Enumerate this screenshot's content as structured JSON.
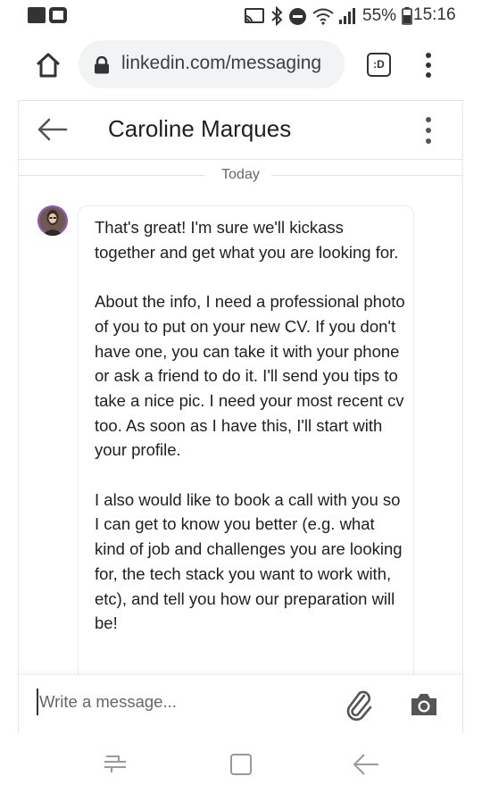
{
  "status_bar": {
    "battery_percent": "55%",
    "time": "15:16",
    "icons": [
      "screen-cast-icon",
      "bluetooth-icon",
      "do-not-disturb-icon",
      "wifi-icon",
      "cell-signal-icon",
      "battery-icon"
    ]
  },
  "browser": {
    "url": "linkedin.com/messaging",
    "tabs_label": ":D"
  },
  "conversation": {
    "contact_name": "Caroline Marques",
    "day_divider": "Today",
    "message": {
      "paragraphs": [
        "That's great! I'm sure we'll kickass together and get what you are looking for.",
        "About the info, I need a professional photo of you to put on your new CV. If you don't have one, you can take it with your phone or ask a friend to do it. I'll send you tips to take a nice pic. I need your most recent cv too. As soon as I have this, I'll start with your profile.",
        "I also would like to book a call with you so I can get to know you better (e.g. what kind of job and challenges you are looking for, the tech stack you want to work with, etc), and tell you how our preparation will be!"
      ]
    }
  },
  "composer": {
    "placeholder": "Write a message...",
    "value": ""
  },
  "colors": {
    "avatar_ring": "#8a5ab0",
    "icon_dark": "#333333",
    "url_field_bg": "#f1f3f4"
  }
}
